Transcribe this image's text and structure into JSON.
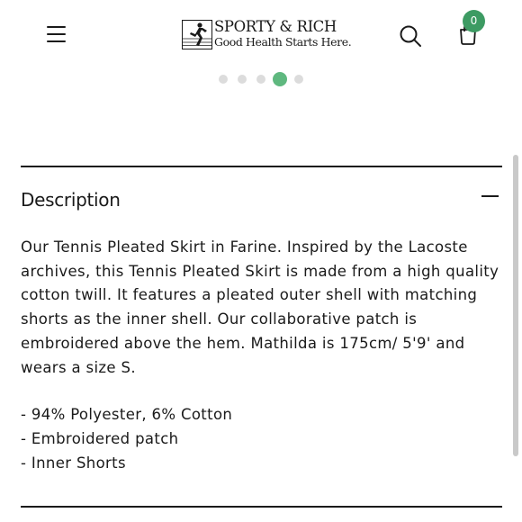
{
  "header": {
    "brand_line1": "SPORTY & RICH",
    "brand_line2": "Good Health Starts Here.",
    "cart_count": "0",
    "icons": {
      "menu": "menu-icon",
      "search": "search-icon",
      "cart": "cart-icon"
    },
    "colors": {
      "badge": "#3d9b63"
    }
  },
  "carousel": {
    "dot_count": 5,
    "active_index": 3,
    "active_color": "#5fb87f"
  },
  "description": {
    "title": "Description",
    "toggle_icon": "minus-icon",
    "paragraph": "Our Tennis Pleated Skirt in Farine. Inspired by the Lacoste archives, this Tennis Pleated Skirt is made from a high quality cotton twill. It features a pleated outer shell with matching shorts as the inner shell. Our collaborative patch is embroidered above the hem. Mathilda is 175cm/ 5'9' and wears a size S.",
    "bullets": [
      "- 94% Polyester, 6% Cotton",
      "- Embroidered patch",
      "- Inner Shorts"
    ]
  }
}
